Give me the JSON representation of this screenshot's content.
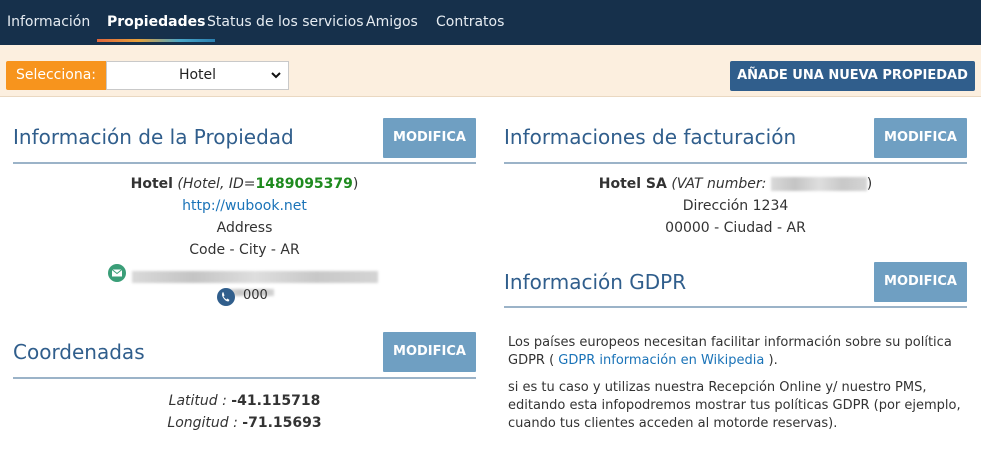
{
  "nav": {
    "tabs": [
      {
        "label": "Información"
      },
      {
        "label": "Propiedades"
      },
      {
        "label": "Status de los servicios"
      },
      {
        "label": "Amigos"
      },
      {
        "label": "Contratos"
      }
    ],
    "active_index": 1
  },
  "selection": {
    "label": "Selecciona:",
    "value": "Hotel",
    "add_button": "AÑADE UNA NUEVA PROPIEDAD"
  },
  "property_info": {
    "title": "Información de la Propiedad",
    "modify": "MODIFICA",
    "name": "Hotel",
    "meta_prefix": "Hotel, ID=",
    "id": "1489095379",
    "website": "http://wubook.net",
    "address": "Address",
    "code_city": "Code - City - AR",
    "phone": "000"
  },
  "billing": {
    "title": "Informaciones de facturación",
    "modify": "MODIFICA",
    "company": "Hotel SA",
    "vat_label": "VAT number:",
    "street": "Dirección 1234",
    "city_line": "00000 - Ciudad - AR"
  },
  "gdpr": {
    "title": "Información GDPR",
    "modify": "MODIFICA",
    "p1_before": "Los países europeos necesitan facilitar información sobre su política GDPR ( ",
    "p1_link": "GDPR información en Wikipedia",
    "p1_after": " ).",
    "p2": "si es tu caso y utilizas nuestra Recepción Online y/ nuestro PMS, editando esta infopodremos mostrar tus políticas GDPR (por ejemplo, cuando tus clientes acceden al motorde reservas)."
  },
  "coords": {
    "title": "Coordenadas",
    "modify": "MODIFICA",
    "lat_label": "Latitud",
    "lat_value": "-41.115718",
    "lng_label": "Longitud",
    "lng_value": "-71.15693"
  },
  "colors": {
    "nav_bg": "#16304b",
    "accent_orange": "#f7941d",
    "primary_blue": "#305e8c",
    "modify_button": "#6f9fc2",
    "id_green": "#1e8a1e",
    "link_blue": "#1a73b8"
  },
  "icons": {
    "email": "email-icon",
    "phone": "phone-icon",
    "dropdown": "chevron-down-icon"
  }
}
